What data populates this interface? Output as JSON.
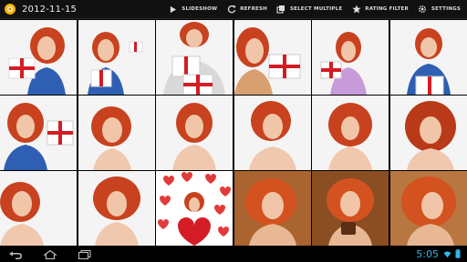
{
  "toolbar": {
    "title": "2012-11-15",
    "actions": [
      {
        "label": "SLIDESHOW",
        "icon": "play-icon"
      },
      {
        "label": "REFRESH",
        "icon": "refresh-icon"
      },
      {
        "label": "SELECT MULTIPLE",
        "icon": "select-multiple-icon"
      },
      {
        "label": "RATING FILTER",
        "icon": "star-icon"
      },
      {
        "label": "SETTINGS",
        "icon": "gear-icon"
      }
    ]
  },
  "colors": {
    "clock": "#33b5e5",
    "hair": "#c8421f",
    "gift_ribbon": "#d41c24",
    "app_icon": "#f5b400"
  },
  "photos": [
    {
      "subject": "woman-with-gift"
    },
    {
      "subject": "woman-with-gift"
    },
    {
      "subject": "woman-with-gifts"
    },
    {
      "subject": "woman-with-gift"
    },
    {
      "subject": "woman-with-gift"
    },
    {
      "subject": "woman-with-gift"
    },
    {
      "subject": "woman-with-gift"
    },
    {
      "subject": "woman-portrait"
    },
    {
      "subject": "woman-portrait"
    },
    {
      "subject": "woman-portrait"
    },
    {
      "subject": "woman-portrait"
    },
    {
      "subject": "woman-portrait"
    },
    {
      "subject": "woman-portrait"
    },
    {
      "subject": "woman-portrait"
    },
    {
      "subject": "woman-with-heart"
    },
    {
      "subject": "woman-portrait"
    },
    {
      "subject": "woman-with-cup"
    },
    {
      "subject": "woman-portrait"
    }
  ],
  "status_bar": {
    "time": "5:05",
    "icons": [
      "wifi-icon",
      "battery-icon"
    ]
  },
  "nav": [
    "back-icon",
    "home-icon",
    "recent-apps-icon"
  ]
}
